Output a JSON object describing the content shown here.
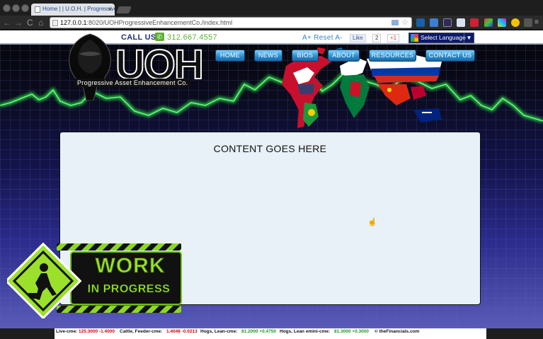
{
  "browser": {
    "tab_title": "Home | | U.O.H. | Progressive",
    "tab_close": "×",
    "url_host": "127.0.0.1",
    "url_rest": ":8020/UOHProgressiveEnhancementCo./index.html",
    "nav_back": "←",
    "nav_forward": "→",
    "nav_reload": "C",
    "nav_home": "⌂"
  },
  "header": {
    "call_us": "CALL US!",
    "phone_glyph": "✆",
    "phone": "312.667.4557",
    "font_controls": "A+ Reset A-",
    "fb_like": "Like",
    "fb_count": "2",
    "gplus": "+1",
    "language_select": "Select Language",
    "language_arrow": "▼"
  },
  "logo": {
    "letters": "UOH",
    "tagline": "Progressive Asset Enhancement Co."
  },
  "nav": {
    "items": [
      "HOME",
      "NEWS",
      "BIOS",
      "ABOUT",
      "RESOURCES",
      "CONTACT US"
    ]
  },
  "main": {
    "heading": "CONTENT GOES HERE"
  },
  "banner": {
    "line1": "WORK",
    "line2": "IN PROGRESS"
  },
  "ticker": {
    "items": [
      {
        "label": "Live-cme:",
        "value": "125.3000 -1.4000"
      },
      {
        "label": "Cattle, Feeder-cme:",
        "value": "1.4048 -0.0213"
      },
      {
        "label": "Hogs, Lean-cme:",
        "value": "81.2000 +0.4750"
      },
      {
        "label": "Hogs, Lean emini-cme:",
        "value": "81.3000 +0.3000"
      }
    ],
    "credit": "© theFinancials.com"
  },
  "colors": {
    "accent_blue": "#2a8ecf",
    "phone_green": "#5cb030",
    "ticker_down": "#d40000",
    "ticker_up": "#1a9a1a"
  }
}
